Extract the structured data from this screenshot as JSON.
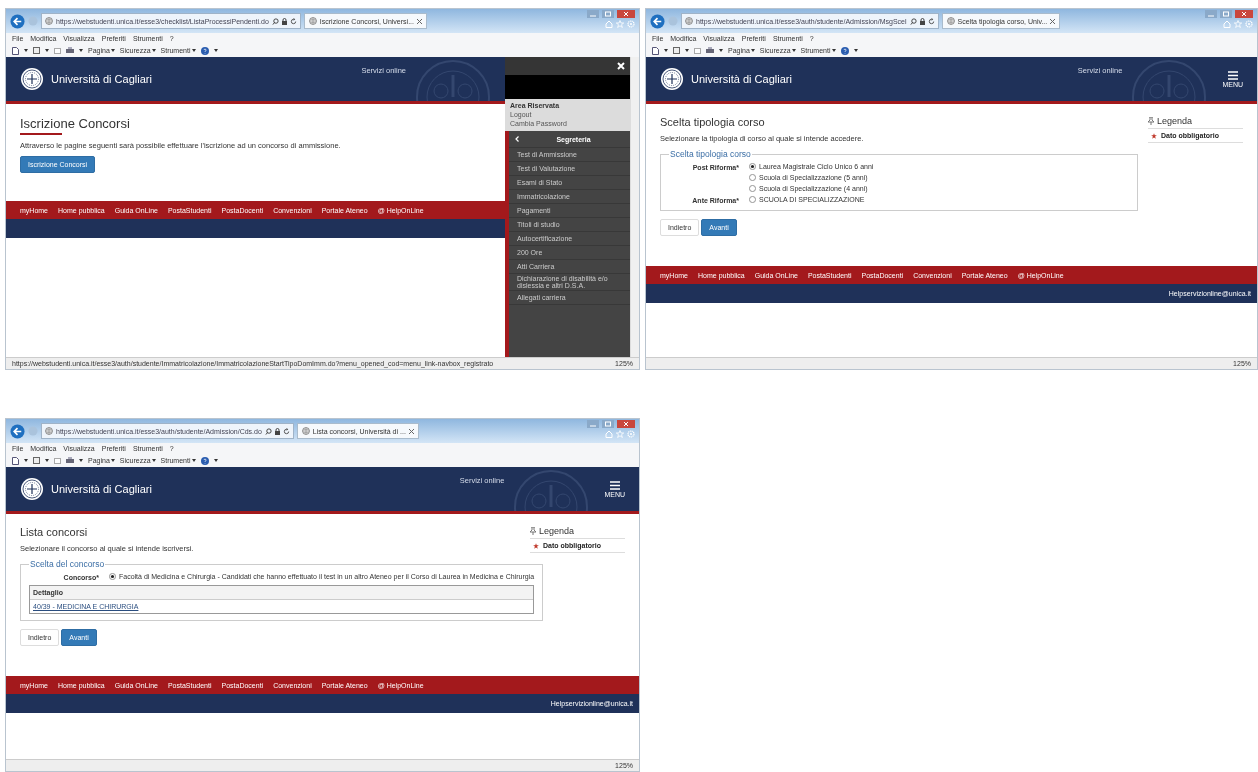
{
  "windows": [
    {
      "kind": "intro",
      "address": "https://webstudenti.unica.it/esse3/checklist/ListaProcessiPendenti.do",
      "tab": "Iscrizione Concorsi, Universi...",
      "menu_bar": [
        "File",
        "Modifica",
        "Visualizza",
        "Preferiti",
        "Strumenti",
        "?"
      ],
      "command_bar": [
        "Pagina",
        "Sicurezza",
        "Strumenti"
      ],
      "header": {
        "title": "Università di Cagliari",
        "services": "Servizi online"
      },
      "page": {
        "title": "Iscrizione Concorsi",
        "text": "Attraverso le pagine seguenti sarà possibile effettuare l'iscrizione ad un concorso di ammissione.",
        "button": "Iscrizione Concorsi"
      },
      "footer_links": [
        "myHome",
        "Home pubblica",
        "Guida OnLine",
        "PostaStudenti",
        "PostaDocenti",
        "Convenzioni",
        "Portale Ateneo",
        "@ HelpOnLine"
      ],
      "side_menu": {
        "account_title": "Area Riservata",
        "account_links": [
          "Logout",
          "Cambia Password"
        ],
        "section": "Segreteria",
        "items": [
          "Test di Ammissione",
          "Test di Valutazione",
          "Esami di Stato",
          "Immatricolazione",
          "Pagamenti",
          "Titoli di studio",
          "Autocertificazione",
          "200 Ore",
          "Atti Carriera",
          "Dichiarazione di disabilità e/o dislessia e altri D.S.A.",
          "Allegati carriera"
        ]
      },
      "status": {
        "url": "https://webstudenti.unica.it/esse3/auth/studente/Immatricolazione/ImmatricolazioneStartTipoDomImm.do?menu_opened_cod=menu_link-navbox_registrato",
        "zoom": "125%"
      }
    },
    {
      "kind": "form",
      "address": "https://webstudenti.unica.it/esse3/auth/studente/Admission/MsgScel",
      "tab": "Scelta tipologia corso, Univ...",
      "menu_bar": [
        "File",
        "Modifica",
        "Visualizza",
        "Preferiti",
        "Strumenti",
        "?"
      ],
      "command_bar": [
        "Pagina",
        "Sicurezza",
        "Strumenti"
      ],
      "header": {
        "title": "Università di Cagliari",
        "services": "Servizi online",
        "menu_label": "MENU"
      },
      "page": {
        "title": "Scelta tipologia corso",
        "text": "Selezionare la tipologia di corso al quale si intende accedere.",
        "fieldset": "Scelta tipologia corso",
        "groups": [
          {
            "label": "Post Riforma*",
            "options": [
              {
                "text": "Laurea Magistrale Ciclo Unico 6 anni",
                "selected": true
              },
              {
                "text": "Scuola di Specializzazione (5 anni)",
                "selected": false
              },
              {
                "text": "Scuola di Specializzazione (4 anni)",
                "selected": false
              }
            ]
          },
          {
            "label": "Ante Riforma*",
            "options": [
              {
                "text": "SCUOLA DI SPECIALIZZAZIONE",
                "selected": false
              }
            ]
          }
        ],
        "buttons": [
          "Indietro",
          "Avanti"
        ],
        "legend": {
          "title": "Legenda",
          "item": "Dato obbligatorio"
        }
      },
      "footer_links": [
        "myHome",
        "Home pubblica",
        "Guida OnLine",
        "PostaStudenti",
        "PostaDocenti",
        "Convenzioni",
        "Portale Ateneo",
        "@ HelpOnLine"
      ],
      "footer_email": "Helpservizionline@unica.it",
      "status": {
        "zoom": "125%"
      }
    },
    {
      "kind": "form",
      "address": "https://webstudenti.unica.it/esse3/auth/studente/Admission/Cds.do",
      "tab": "Lista concorsi, Università di ...",
      "menu_bar": [
        "File",
        "Modifica",
        "Visualizza",
        "Preferiti",
        "Strumenti",
        "?"
      ],
      "command_bar": [
        "Pagina",
        "Sicurezza",
        "Strumenti"
      ],
      "header": {
        "title": "Università di Cagliari",
        "services": "Servizi online",
        "menu_label": "MENU"
      },
      "page": {
        "title": "Lista concorsi",
        "text": "Selezionare il concorso al quale si intende iscriversi.",
        "fieldset": "Scelta del concorso",
        "groups": [
          {
            "label": "Concorso*",
            "options": [
              {
                "text": "Facoltà di Medicina e Chirurgia - Candidati che hanno effettuato il test in un altro Ateneo per il Corso di Laurea in Medicina e Chirurgia",
                "selected": true
              }
            ]
          }
        ],
        "table": {
          "header": "Dettaglio",
          "rows": [
            "40/39 - MEDICINA E CHIRURGIA"
          ]
        },
        "buttons": [
          "Indietro",
          "Avanti"
        ],
        "legend": {
          "title": "Legenda",
          "item": "Dato obbligatorio"
        }
      },
      "footer_links": [
        "myHome",
        "Home pubblica",
        "Guida OnLine",
        "PostaStudenti",
        "PostaDocenti",
        "Convenzioni",
        "Portale Ateneo",
        "@ HelpOnLine"
      ],
      "footer_email": "Helpservizionline@unica.it",
      "status": {
        "zoom": "125%"
      }
    }
  ]
}
